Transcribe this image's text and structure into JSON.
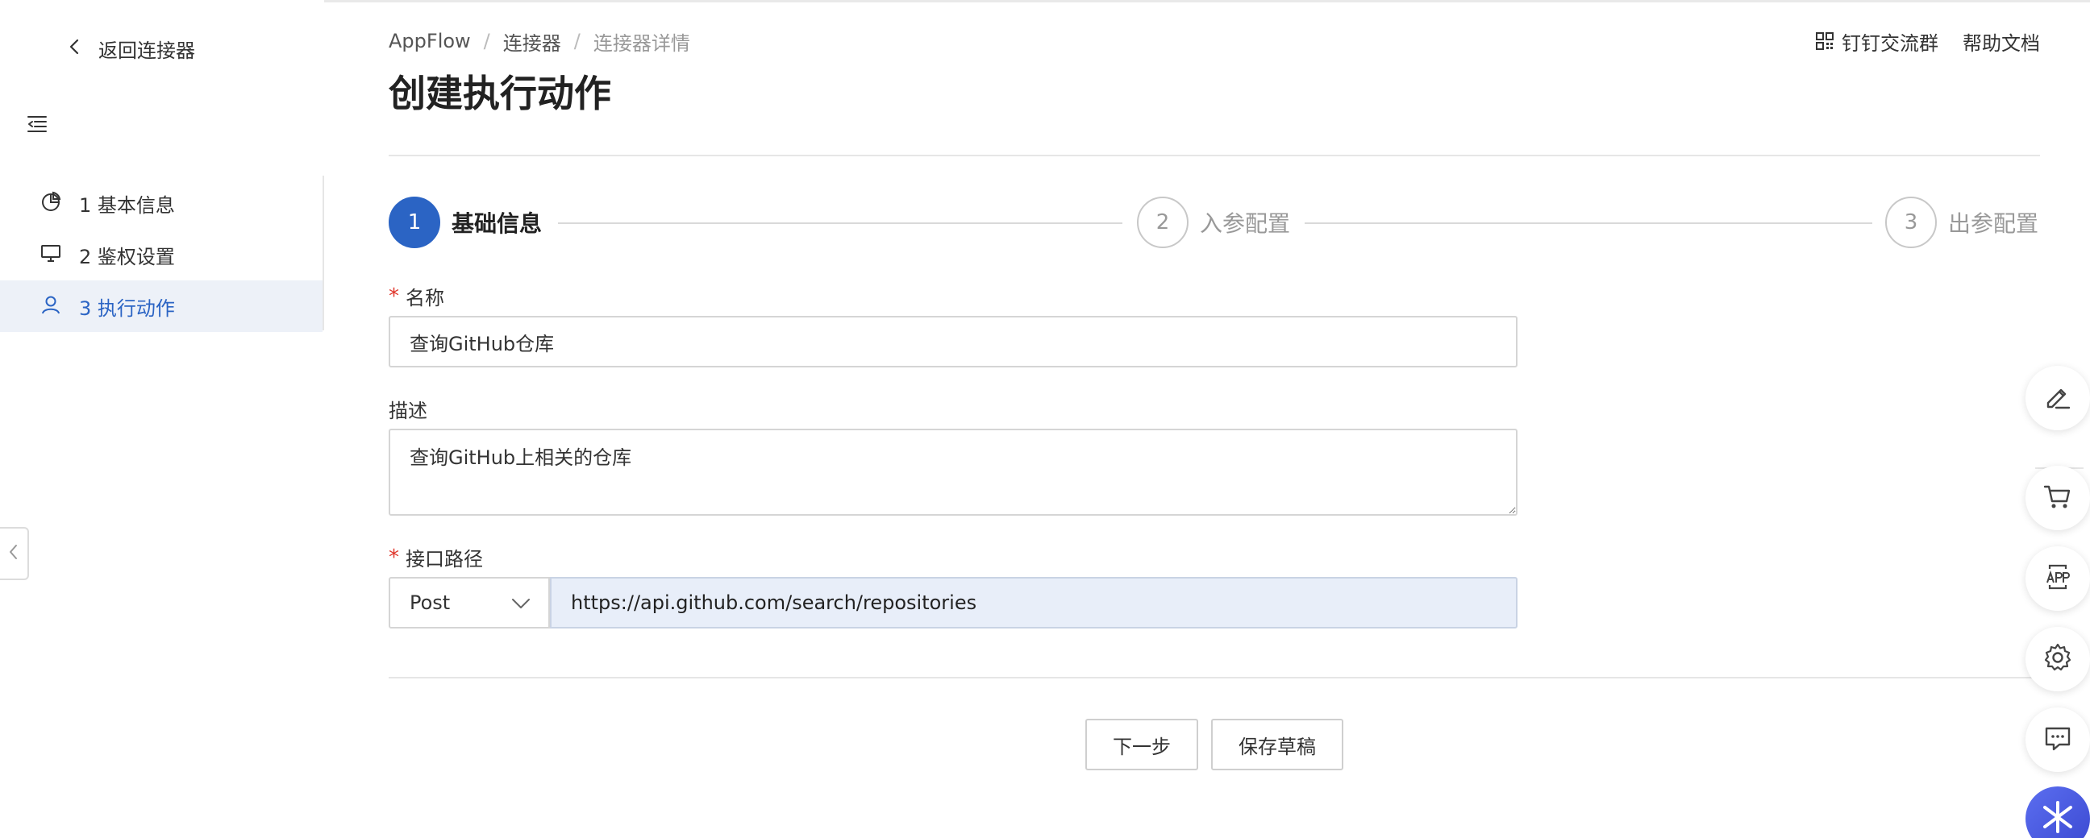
{
  "sidebar": {
    "back_label": "返回连接器",
    "items": [
      {
        "label": "1 基本信息",
        "icon": "pie-chart-icon"
      },
      {
        "label": "2 鉴权设置",
        "icon": "monitor-icon"
      },
      {
        "label": "3 执行动作",
        "icon": "user-icon",
        "active": true
      }
    ]
  },
  "header": {
    "breadcrumb": [
      "AppFlow",
      "连接器",
      "连接器详情"
    ],
    "title": "创建执行动作",
    "links": {
      "dingtalk": "钉钉交流群",
      "help": "帮助文档"
    }
  },
  "steps": [
    {
      "number": "1",
      "label": "基础信息",
      "active": true
    },
    {
      "number": "2",
      "label": "入参配置",
      "active": false
    },
    {
      "number": "3",
      "label": "出参配置",
      "active": false
    }
  ],
  "form": {
    "name": {
      "label": "名称",
      "required": true,
      "value": "查询GitHub仓库"
    },
    "description": {
      "label": "描述",
      "required": false,
      "value": "查询GitHub上相关的仓库"
    },
    "path": {
      "label": "接口路径",
      "required": true,
      "method": "Post",
      "value": "https://api.github.com/search/repositories"
    }
  },
  "actions": {
    "next": "下一步",
    "save_draft": "保存草稿"
  },
  "floating_tools": [
    "edit-icon",
    "cart-icon",
    "app-icon",
    "gear-icon",
    "chat-icon"
  ],
  "colors": {
    "accent": "#2b64c4",
    "active_bg": "#edf1f8",
    "required": "#e0372c",
    "path_bg": "#e8eef9"
  }
}
